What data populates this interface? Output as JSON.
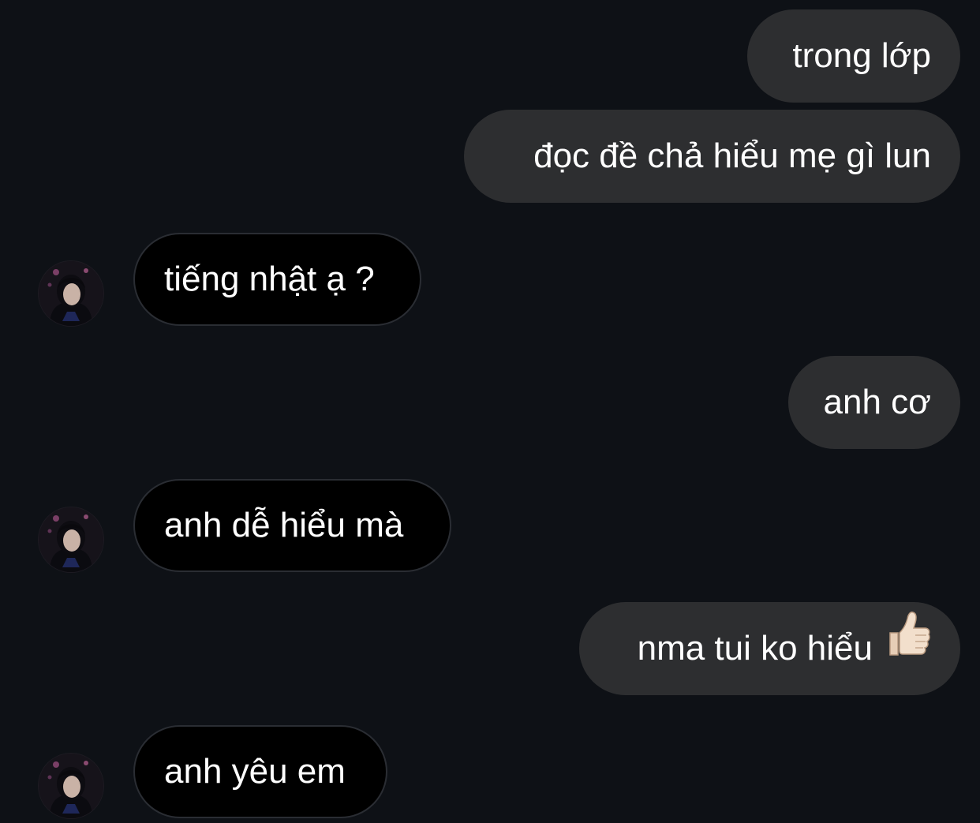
{
  "messages": [
    {
      "direction": "sent",
      "text": "trong lớp"
    },
    {
      "direction": "sent",
      "text": "đọc đề chả hiểu mẹ gì lun"
    },
    {
      "direction": "received",
      "text": "tiếng nhật ạ ?"
    },
    {
      "direction": "sent",
      "text": "anh cơ"
    },
    {
      "direction": "received",
      "text": "anh dễ hiểu mà"
    },
    {
      "direction": "sent",
      "text": "nma tui ko hiểu",
      "emoji": "thumbs-up-icon"
    },
    {
      "direction": "received",
      "text": "anh yêu em"
    }
  ],
  "colors": {
    "background": "#0e1116",
    "sent_bubble": "#2d2e30",
    "received_bubble": "#000000",
    "text": "#ffffff"
  }
}
